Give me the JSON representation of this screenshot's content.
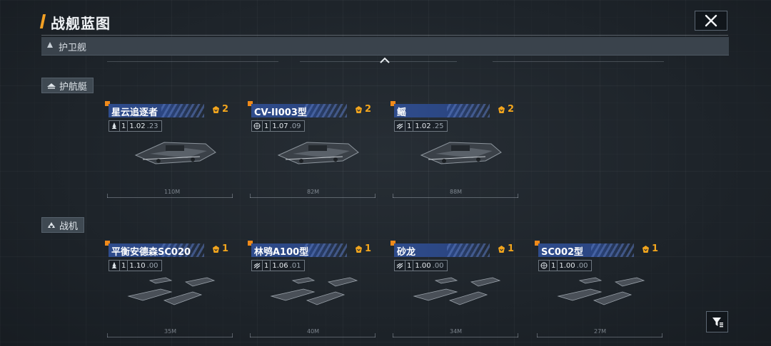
{
  "header": {
    "title": "战舰蓝图"
  },
  "category": {
    "label": "护卫舰"
  },
  "sections": [
    {
      "label": "护航艇",
      "icon": "escort-boat-icon",
      "ships": [
        {
          "name": "星云追逐者",
          "badge": "2",
          "type_icon": "missile-icon",
          "level": "1",
          "stat": "1.02",
          "stat_dim": ".23",
          "length": "110M"
        },
        {
          "name": "CV-II003型",
          "badge": "2",
          "type_icon": "globe-icon",
          "level": "1",
          "stat": "1.07",
          "stat_dim": ".09",
          "length": "82M"
        },
        {
          "name": "鳐",
          "badge": "2",
          "type_icon": "speed-icon",
          "level": "1",
          "stat": "1.02",
          "stat_dim": ".25",
          "length": "88M"
        }
      ]
    },
    {
      "label": "战机",
      "icon": "fighter-icon",
      "ships": [
        {
          "name": "平衡安德森SC020",
          "badge": "1",
          "type_icon": "missile-icon",
          "level": "1",
          "stat": "1.10",
          "stat_dim": ".00",
          "length": "35M"
        },
        {
          "name": "林鸮A100型",
          "badge": "1",
          "type_icon": "speed-icon",
          "level": "1",
          "stat": "1.06",
          "stat_dim": ".01",
          "length": "40M"
        },
        {
          "name": "砂龙",
          "badge": "1",
          "type_icon": "speed-icon",
          "level": "1",
          "stat": "1.00",
          "stat_dim": ".00",
          "length": "34M"
        },
        {
          "name": "SC002型",
          "badge": "1",
          "type_icon": "globe-icon",
          "level": "1",
          "stat": "1.00",
          "stat_dim": ".00",
          "length": "27M"
        }
      ]
    }
  ],
  "colors": {
    "accent": "#f2a024",
    "namebar": "#2f4c8c",
    "badge": "#f2a51d"
  }
}
